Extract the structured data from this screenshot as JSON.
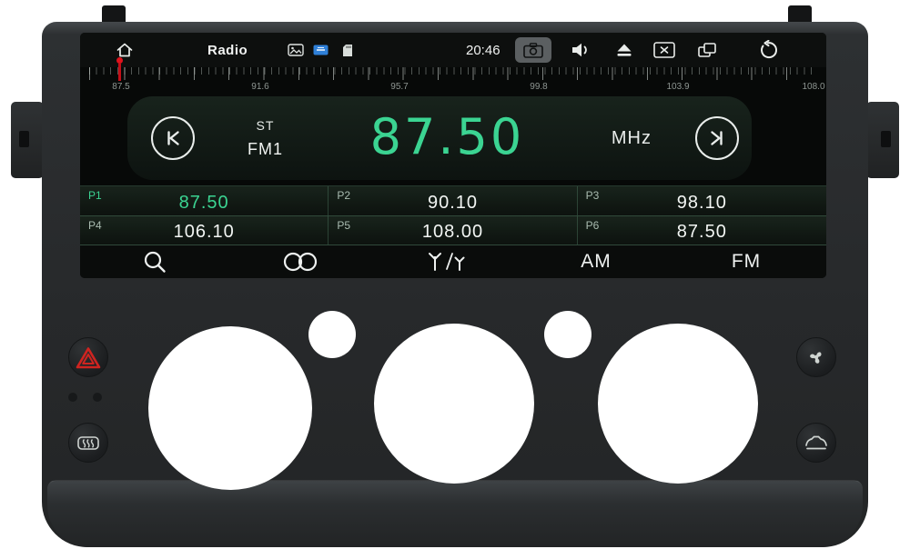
{
  "status_bar": {
    "app_label": "Radio",
    "time": "20:46"
  },
  "tuner_scale": {
    "labels": [
      "87.5",
      "91.6",
      "95.7",
      "99.8",
      "103.9",
      "108.0"
    ]
  },
  "radio_display": {
    "stereo_indicator": "ST",
    "band": "FM1",
    "frequency": "87.50",
    "unit": "MHz"
  },
  "presets": [
    {
      "label": "P1",
      "value": "87.50"
    },
    {
      "label": "P2",
      "value": "90.10"
    },
    {
      "label": "P3",
      "value": "98.10"
    },
    {
      "label": "P4",
      "value": "106.10"
    },
    {
      "label": "P5",
      "value": "108.00"
    },
    {
      "label": "P6",
      "value": "87.50"
    }
  ],
  "bottom_bar": {
    "am": "AM",
    "fm": "FM"
  },
  "icons": {
    "home": "house-outline",
    "gallery": "picture-frame",
    "hdmi": "blue-hdmi-badge",
    "sd_card": "sd-card",
    "screenshot": "camera",
    "volume": "speaker",
    "eject": "eject-triangle",
    "close_window": "x-in-box",
    "floating_windows": "overlapping-rects",
    "back": "curved-return-arrow",
    "seek_down": "skip-back",
    "seek_up": "skip-forward",
    "search": "magnifier",
    "dual_zone": "double-circles",
    "loc_dx": "two-antennas-slash",
    "hazard": "red-warning-triangle",
    "rear_defrost": "defrost-waves",
    "fan": "fan-blades",
    "vent": "car-outline"
  },
  "colors": {
    "accent_green": "#3bd492",
    "pointer_red": "#d4131c",
    "hdmi_badge_blue": "#2f80d8",
    "hazard_red": "#cf2420",
    "bezel_dark": "#27292b",
    "screen_black": "#070908"
  }
}
